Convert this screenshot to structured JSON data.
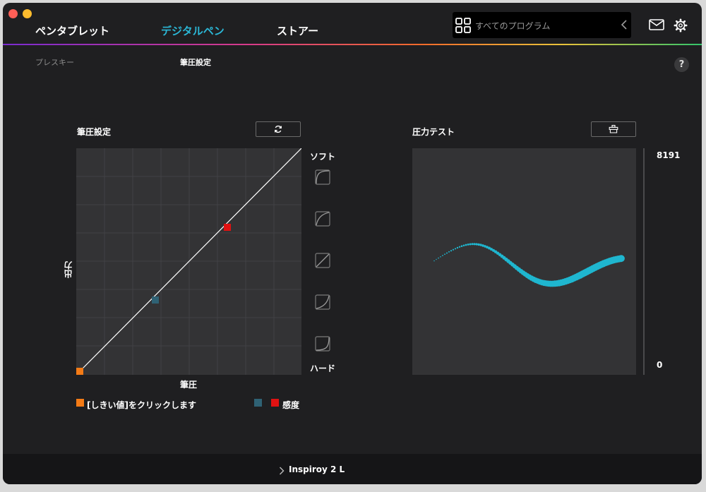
{
  "nav": {
    "tabs": [
      {
        "label": "ペンタブレット"
      },
      {
        "label": "デジタルペン"
      },
      {
        "label": "ストアー"
      }
    ],
    "active_tab": 1,
    "program_select_label": "すべてのプログラム"
  },
  "subtabs": [
    {
      "label": "プレスキー"
    },
    {
      "label": "筆圧設定"
    }
  ],
  "pressure_settings": {
    "title": "筆圧設定",
    "y_axis_label": "出力",
    "x_axis_label": "筆圧",
    "soft_label": "ソフト",
    "hard_label": "ハード",
    "curve_presets": [
      "soft-curve-1",
      "soft-curve-2",
      "linear",
      "hard-curve-1",
      "hard-curve-2"
    ],
    "legend": {
      "threshold_label": "[しきい値]をクリックします",
      "sensitivity_label": "感度"
    },
    "colors": {
      "threshold": "#f47b16",
      "sensitivity_low": "#2f6275",
      "sensitivity_high": "#e01212"
    }
  },
  "pressure_test": {
    "title": "圧力テスト",
    "max_value": "8191",
    "min_value": "0",
    "stroke_color": "#1fb6cf"
  },
  "device": {
    "name": "Inspiroy 2 L"
  },
  "icons": {
    "refresh": "refresh-icon",
    "clear": "eraser-icon",
    "mail": "mail-icon",
    "settings": "gear-icon",
    "help": "help-icon"
  }
}
